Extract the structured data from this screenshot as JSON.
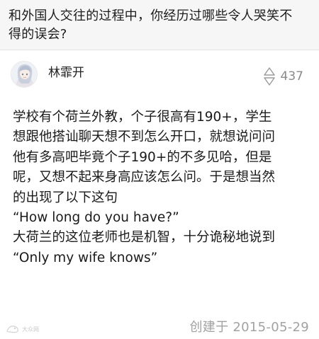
{
  "question": {
    "title_lines": [
      "和外国人交往的过程中，你经历过哪些令人哭笑不",
      "得的误会?"
    ]
  },
  "author": {
    "name": "林霏开",
    "avatar_icon": "avatar-illustration"
  },
  "vote": {
    "icon": "up-down-triangle-icon",
    "count": "437"
  },
  "answer": {
    "lines": [
      "学校有个荷兰外教，个子很高有190+，学生",
      "想跟他搭讪聊天想不到怎么开口，就想说问问",
      "他有多高吧毕竟个子190+的不多见哈，但是",
      "呢，又想不起来身高应该怎么问。于是想当然",
      "的出现了以下这句",
      "“How long do you have?”",
      "大荷兰的这位老师也是机智，十分诡秘地说到",
      "“Only my wife knows”"
    ]
  },
  "footer": {
    "created": "创建于 2015-05-29",
    "watermark": "大众网"
  },
  "colors": {
    "question_bg": "#f6f6f6",
    "body_text": "#1a1a1a",
    "muted_text": "#a2a2a2",
    "vote_text": "#8a8a8a"
  }
}
